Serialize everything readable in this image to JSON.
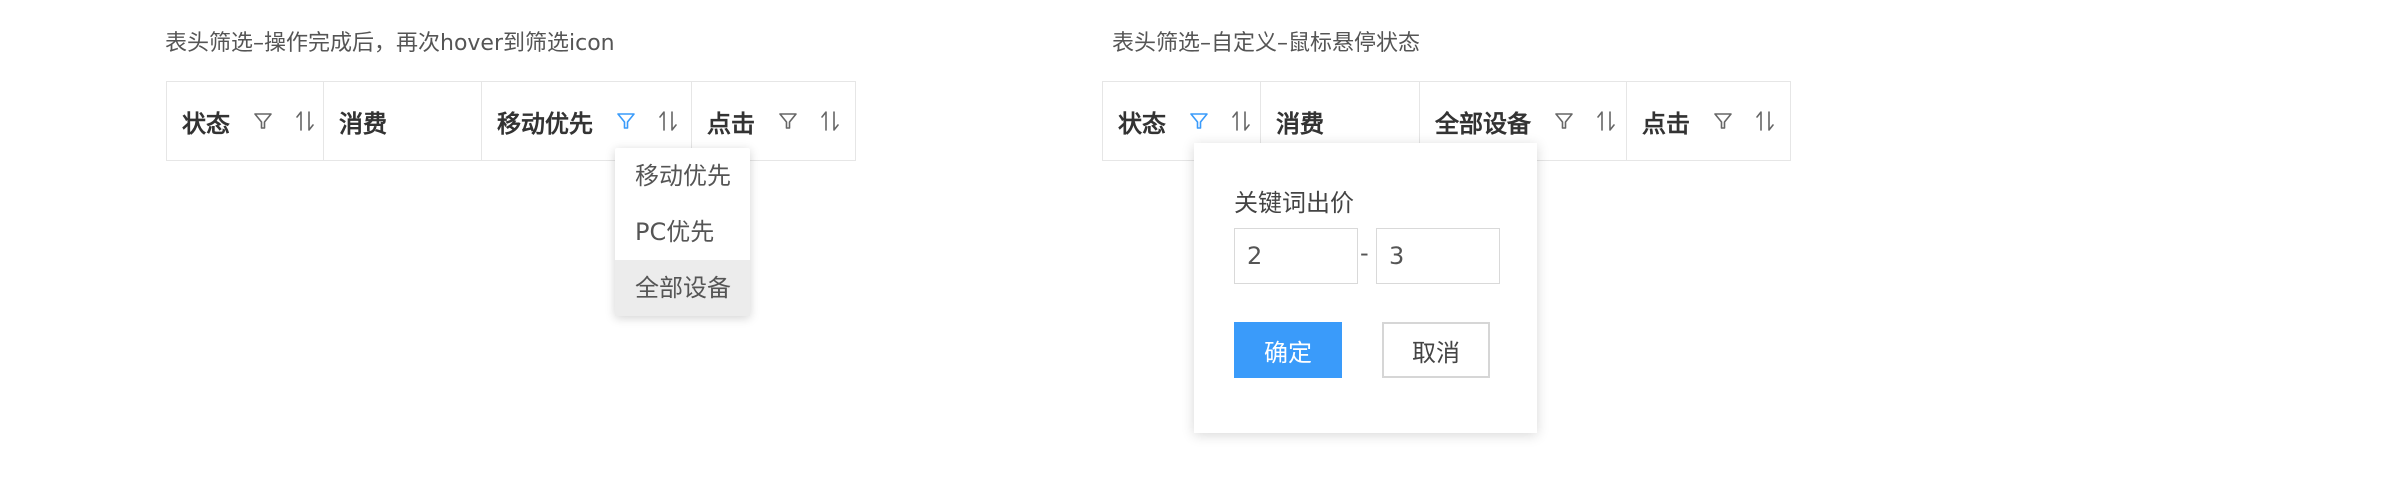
{
  "left_panel": {
    "caption": "表头筛选–操作完成后，再次hover到筛选icon",
    "columns": [
      {
        "label": "状态",
        "filter_icon": "filter-icon",
        "sort_icon": "sort-icon",
        "filter_active": false
      },
      {
        "label": "消费"
      },
      {
        "label": "移动优先",
        "filter_icon": "filter-icon",
        "sort_icon": "sort-icon",
        "filter_active": true
      },
      {
        "label": "点击",
        "filter_icon": "filter-icon",
        "sort_icon": "sort-icon",
        "filter_active": false
      }
    ],
    "dropdown": {
      "options": [
        "移动优先",
        "PC优先",
        "全部设备"
      ],
      "hovered_option": "全部设备"
    }
  },
  "right_panel": {
    "caption": "表头筛选–自定义–鼠标悬停状态",
    "columns": [
      {
        "label": "状态",
        "filter_icon": "filter-icon",
        "sort_icon": "sort-icon",
        "filter_active": true
      },
      {
        "label": "消费"
      },
      {
        "label": "全部设备",
        "filter_icon": "filter-icon",
        "sort_icon": "sort-icon",
        "filter_active": false
      },
      {
        "label": "点击",
        "filter_icon": "filter-icon",
        "sort_icon": "sort-icon",
        "filter_active": false
      }
    ],
    "popover": {
      "title": "关键词出价",
      "min_value": "2",
      "separator": "-",
      "max_value": "3",
      "confirm_label": "确定",
      "cancel_label": "取消"
    }
  },
  "colors": {
    "accent": "#3a9bfa",
    "icon_default": "#666666",
    "border": "#e6e6e6",
    "hover_bg": "#ececec"
  }
}
